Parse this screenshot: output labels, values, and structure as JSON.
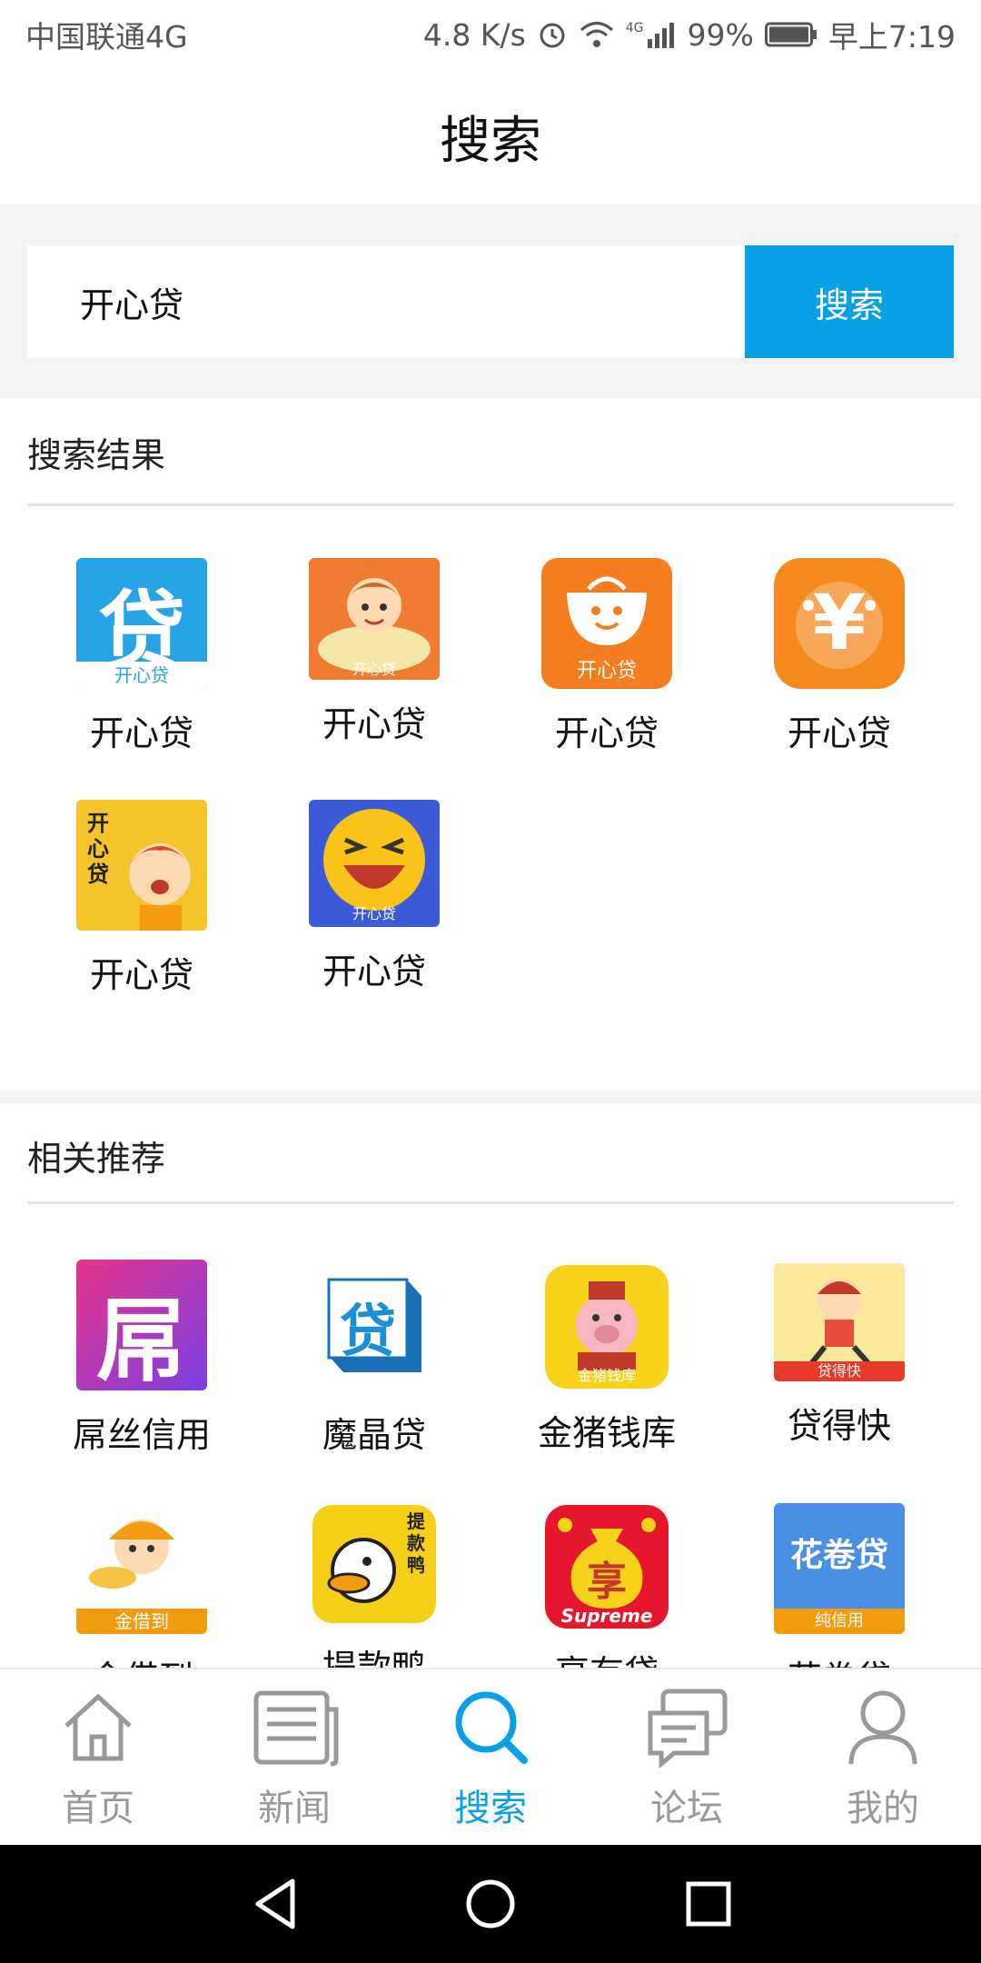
{
  "status_bar": {
    "carrier": "中国联通4G",
    "speed": "4.8 K/s",
    "signal_badge": "4G",
    "battery": "99%",
    "time": "早上7:19"
  },
  "header": {
    "title": "搜索"
  },
  "search": {
    "value": "开心贷",
    "button_label": "搜索"
  },
  "results": {
    "title": "搜索结果",
    "items": [
      {
        "label": "开心贷",
        "icon": "kaixin-dai-blue-icon",
        "icon_text": "贷",
        "icon_caption": "开心贷"
      },
      {
        "label": "开心贷",
        "icon": "kaixin-dai-cartoon-boy-icon",
        "icon_caption": "开心贷"
      },
      {
        "label": "开心贷",
        "icon": "kaixin-dai-orange-bag-icon",
        "icon_caption": "开心贷"
      },
      {
        "label": "开心贷",
        "icon": "kaixin-dai-yen-face-icon",
        "icon_text": "¥"
      },
      {
        "label": "开心贷",
        "icon": "kaixin-dai-yellow-girl-icon",
        "icon_text": "开心贷"
      },
      {
        "label": "开心贷",
        "icon": "kaixin-dai-laughing-face-icon",
        "icon_caption": "开心贷"
      }
    ]
  },
  "recommend": {
    "title": "相关推荐",
    "items": [
      {
        "label": "屌丝信用",
        "icon": "diaosi-credit-icon",
        "icon_text": "屌"
      },
      {
        "label": "魔晶贷",
        "icon": "mojing-dai-cube-icon",
        "icon_text": "贷"
      },
      {
        "label": "金猪钱库",
        "icon": "golden-pig-icon",
        "icon_caption": "金猪钱库"
      },
      {
        "label": "贷得快",
        "icon": "running-girl-icon",
        "icon_caption": "贷得快"
      },
      {
        "label": "金借到",
        "icon": "gold-boy-icon",
        "icon_caption": "金借到"
      },
      {
        "label": "提款鸭",
        "icon": "duck-icon",
        "icon_text": "提款鸭"
      },
      {
        "label": "享有贷",
        "icon": "money-bag-icon",
        "icon_text": "享",
        "icon_caption": "Supreme"
      },
      {
        "label": "花卷贷",
        "icon": "huajuan-dai-icon",
        "icon_text": "花卷贷",
        "icon_caption": "纯信用"
      }
    ]
  },
  "tabbar": {
    "items": [
      {
        "label": "首页",
        "icon": "home-icon"
      },
      {
        "label": "新闻",
        "icon": "news-icon"
      },
      {
        "label": "搜索",
        "icon": "search-icon"
      },
      {
        "label": "论坛",
        "icon": "forum-icon"
      },
      {
        "label": "我的",
        "icon": "profile-icon"
      }
    ],
    "active": "搜索"
  },
  "colors": {
    "accent": "#0aa0e6",
    "inactive": "#999999"
  }
}
